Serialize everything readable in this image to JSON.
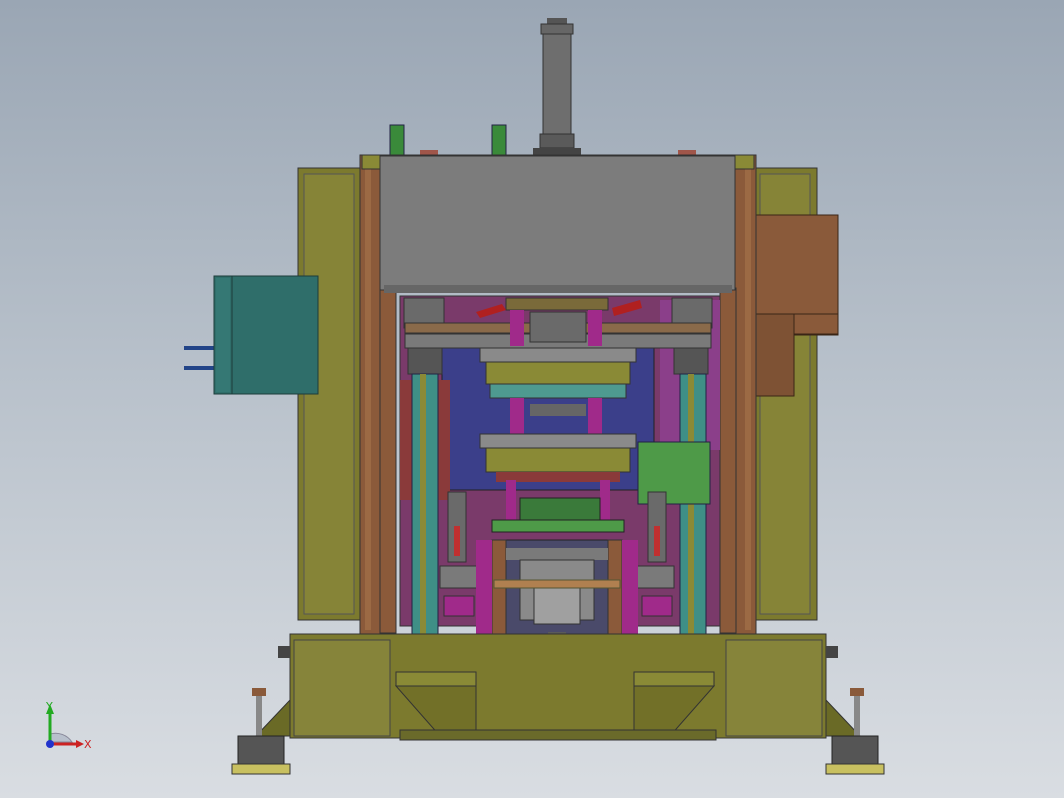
{
  "app": {
    "view": "front",
    "background_top": "#9aa6b4",
    "background_bottom": "#d9dde2"
  },
  "model": {
    "colors": {
      "frame_olive": "#7a7a2e",
      "frame_olive_light": "#8e8e3a",
      "plate_gray": "#7c7c7c",
      "cabinet_teal": "#2f6e6a",
      "motor_brown": "#8a5a3a",
      "column_teal": "#3f8f86",
      "part_magenta": "#a02a8a",
      "part_blue": "#3b3f8a",
      "part_green": "#4e9a48",
      "cylinder_gray": "#5c5c5c",
      "rod_tan": "#b08050"
    }
  },
  "triad": {
    "x_label": "X",
    "y_label": "Y",
    "x_color": "#cc2222",
    "y_color": "#22aa22",
    "z_color": "#2233cc"
  }
}
